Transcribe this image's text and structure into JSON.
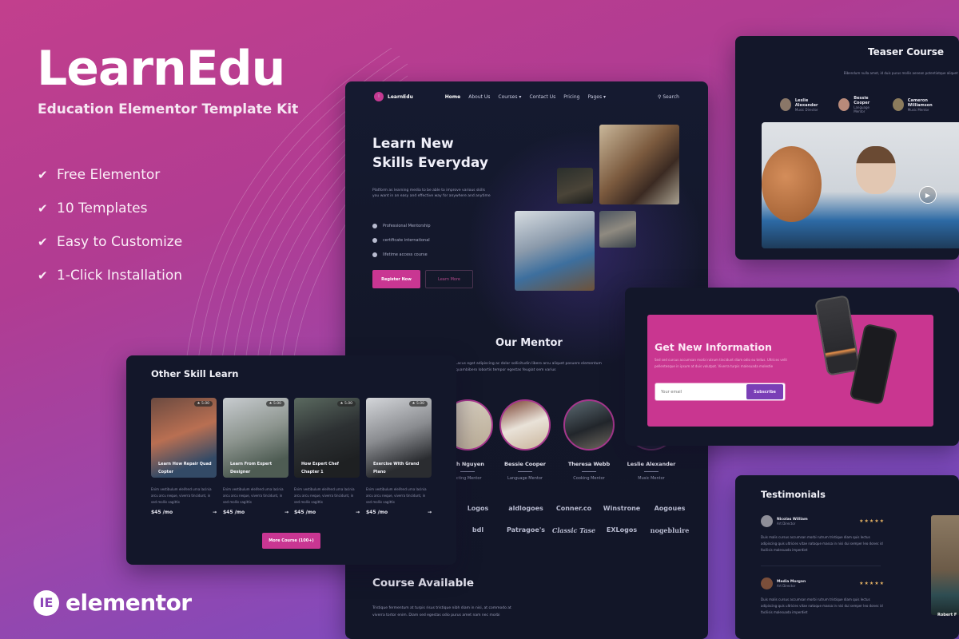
{
  "hero": {
    "title": "LearnEdu",
    "subtitle": "Education Elementor Template Kit",
    "features": [
      "Free Elementor",
      "10 Templates",
      "Easy to Customize",
      "1-Click Installation"
    ],
    "brand": "elementor"
  },
  "colors": {
    "accent": "#c93692",
    "panel": "#13172a",
    "purple": "#7a3fb6"
  },
  "main_preview": {
    "logo": "LearnEdu",
    "nav": [
      "Home",
      "About Us",
      "Courses",
      "Contact Us",
      "Pricing",
      "Pages"
    ],
    "search": "Search",
    "heading_line1": "Learn New",
    "heading_line2": "Skills Everyday",
    "intro": "Platform as learning media to be able to improve various skills you want in an easy and effective way for anywhere and anytime",
    "checklist": [
      "Professional Mentorship",
      "certificate international",
      "lifetime access course"
    ],
    "register_btn": "Register Now",
    "learn_btn": "Learn More",
    "mentor_title": "Our Mentor",
    "mentor_desc": "Lacus eget adipiscing ac dolor sollicitudin libero arcu aliquet posuere elementum quambibero lobortis tempor egestas feugiat sem varius",
    "mentors": [
      {
        "name": "Jah Nguyen",
        "role": "Acting Mentor"
      },
      {
        "name": "Bessie Cooper",
        "role": "Language Mentor"
      },
      {
        "name": "Theresa Webb",
        "role": "Cooking Mentor"
      },
      {
        "name": "Leslie Alexander",
        "role": "Music Mentor"
      }
    ],
    "logos": [
      "Logos",
      "aldlogoes",
      "Conner.co",
      "Winstrone",
      "Aogoues",
      "bdl",
      "Patragoe's",
      "Classic Tase",
      "EXLogos",
      "nogebluire"
    ],
    "course_title": "Course Available",
    "course_desc": "Tristique fermentum at turpis risus tristique nibh diam in nisi, at commodo at viverra tortor enim. Diam sed egestas odio purus amet nam nec morbi"
  },
  "teaser": {
    "title": "Teaser Course",
    "desc": "Bibendum nulla amet, id duis purus mollis aenean potentiatque aliquet felis",
    "people": [
      {
        "name": "Leslie Alexander",
        "role": "Music Director"
      },
      {
        "name": "Bessie Cooper",
        "role": "Language Mentor"
      },
      {
        "name": "Cameron Williamson",
        "role": "Music Mentor"
      }
    ]
  },
  "newsletter": {
    "title": "Get New Information",
    "desc": "Sed sed curcus accumsan morbi rutrum tincidunt diam odio eu tellus. Ultrices velit pellentesque in ipsum at duis volutpat. Viverra turpis malesuada molestie",
    "placeholder": "Your email",
    "button": "Subscribe"
  },
  "skills": {
    "title": "Other Skill Learn",
    "cards": [
      {
        "title": "Learn How Repair Quad Copter",
        "rating": "5.00",
        "desc": "Enim vestibulum eleifend urna lacinia arcu arcu neque, viverra tincidunt, in sed mollis sagittis",
        "price": "$45 /mo"
      },
      {
        "title": "Learn From Expert Designer",
        "rating": "5.00",
        "desc": "Enim vestibulum eleifend urna lacinia arcu arcu neque, viverra tincidunt, in sed mollis sagittis",
        "price": "$45 /mo"
      },
      {
        "title": "How Expert Chef Chapter 1",
        "rating": "5.00",
        "desc": "Enim vestibulum eleifend urna lacinia arcu arcu neque, viverra tincidunt, in sed mollis sagittis",
        "price": "$45 /mo"
      },
      {
        "title": "Exercise With Grand Piano",
        "rating": "5.00",
        "desc": "Enim vestibulum eleifend urna lacinia arcu arcu neque, viverra tincidunt, in sed mollis sagittis",
        "price": "$45 /mo"
      }
    ],
    "more_btn": "More Course (100+)"
  },
  "testimonials": {
    "title": "Testimonials",
    "items": [
      {
        "name": "Nicolas William",
        "role": "Art Director",
        "stars": "★★★★★",
        "text": "Duis malis cursus accumsan morbi rutrum tristique diam quis lectus adipiscing quis ultricies vitae natoque massa in nisi dui semper leo donec id facilisis malesuada imperdiet"
      },
      {
        "name": "Media Morgan",
        "role": "Art Director",
        "stars": "★★★★★",
        "text": "Duis malis cursus accumsan morbi rutrum tristique diam quis lectus adipiscing quis ultricies vitae natoque massa in nisi dui semper leo donec id facilisis malesuada imperdiet"
      }
    ],
    "side_name": "Robert F"
  }
}
